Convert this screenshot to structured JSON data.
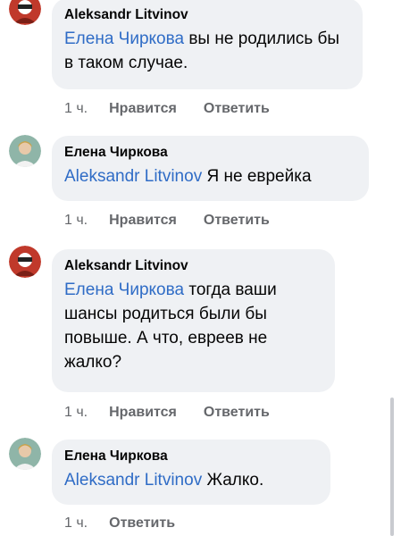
{
  "comments": [
    {
      "author": "Aleksandr Litvinov",
      "mention": "Елена Чиркова",
      "text": " вы не родились бы в таком случае.",
      "time": "1 ч.",
      "like_label": "Нравится",
      "reply_label": "Ответить",
      "avatar_icon": "red-masked-avatar-icon"
    },
    {
      "author": "Елена Чиркова",
      "mention": "Aleksandr Litvinov",
      "text": " Я не еврейка",
      "time": "1 ч.",
      "like_label": "Нравится",
      "reply_label": "Ответить",
      "avatar_icon": "woman-photo-avatar-icon"
    },
    {
      "author": "Aleksandr Litvinov",
      "mention": "Елена Чиркова",
      "text": " тогда ваши шансы родиться были бы повыше. А что, евреев не жалко?",
      "time": "1 ч.",
      "like_label": "Нравится",
      "reply_label": "Ответить",
      "avatar_icon": "red-masked-avatar-icon"
    },
    {
      "author": "Елена Чиркова",
      "mention": "Aleksandr Litvinov",
      "text": " Жалко.",
      "time": "1 ч.",
      "reply_label": "Ответить",
      "avatar_icon": "woman-photo-avatar-icon"
    }
  ],
  "colors": {
    "bubble": "#eff1f4",
    "mention": "#2f6cc6",
    "meta": "#65676b"
  }
}
